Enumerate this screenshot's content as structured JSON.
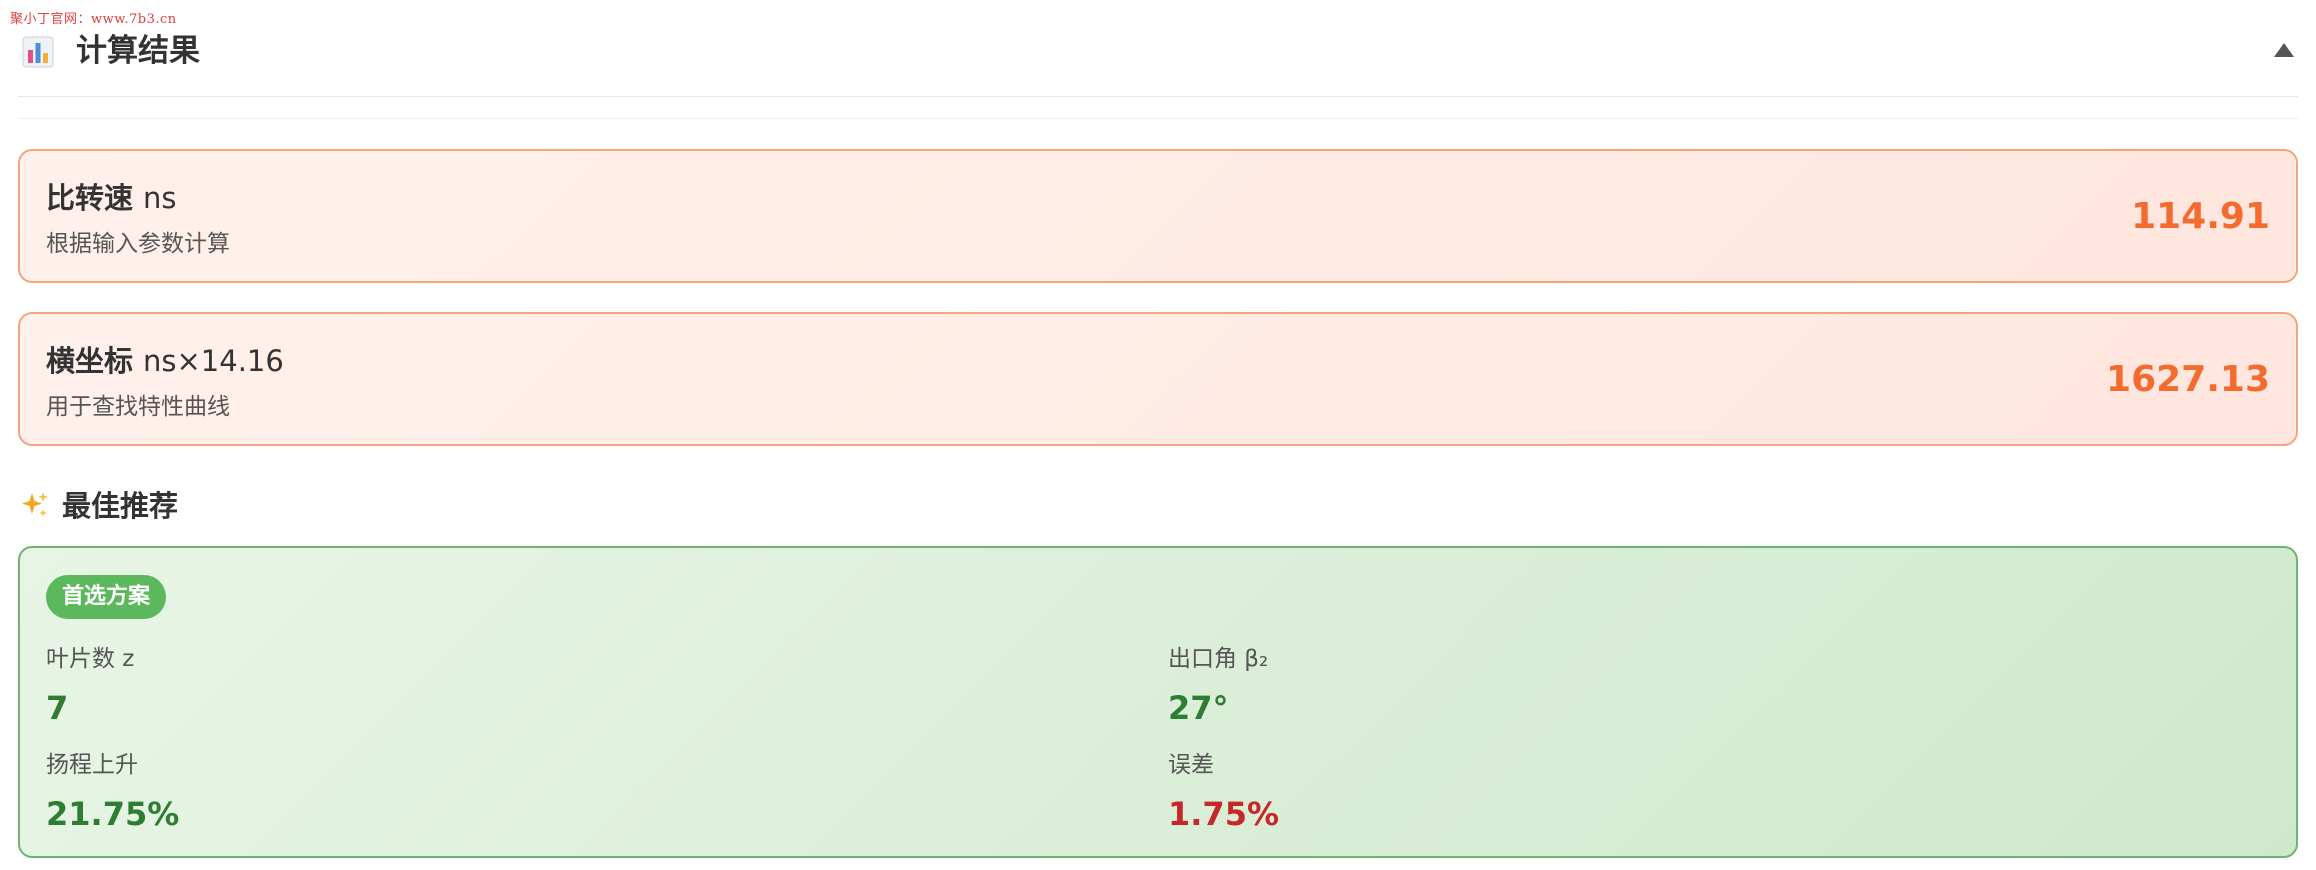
{
  "watermark": "聚小丁官网：www.7b3.cn",
  "header": {
    "title": "计算结果",
    "icon": "bar-chart-icon",
    "collapse_icon": "triangle-up-icon"
  },
  "results": [
    {
      "title": "比转速",
      "symbol": "ns",
      "description": "根据输入参数计算",
      "value": "114.91"
    },
    {
      "title": "横坐标",
      "symbol": "ns×14.16",
      "description": "用于查找特性曲线",
      "value": "1627.13"
    }
  ],
  "recommendation": {
    "heading": "最佳推荐",
    "heading_icon": "sparkles-icon",
    "badge": "首选方案",
    "metrics": [
      {
        "label": "叶片数 z",
        "value": "7"
      },
      {
        "label": "出口角 β₂",
        "value": "27°"
      },
      {
        "label": "扬程上升",
        "value": "21.75%"
      },
      {
        "label": "误差",
        "value": "1.75%"
      }
    ]
  },
  "colors": {
    "accent_orange": "#f46b2f",
    "card_orange_border": "#f3a57e",
    "accent_green": "#2e7d32",
    "badge_green": "#5cb85c",
    "error_red": "#c62828"
  }
}
